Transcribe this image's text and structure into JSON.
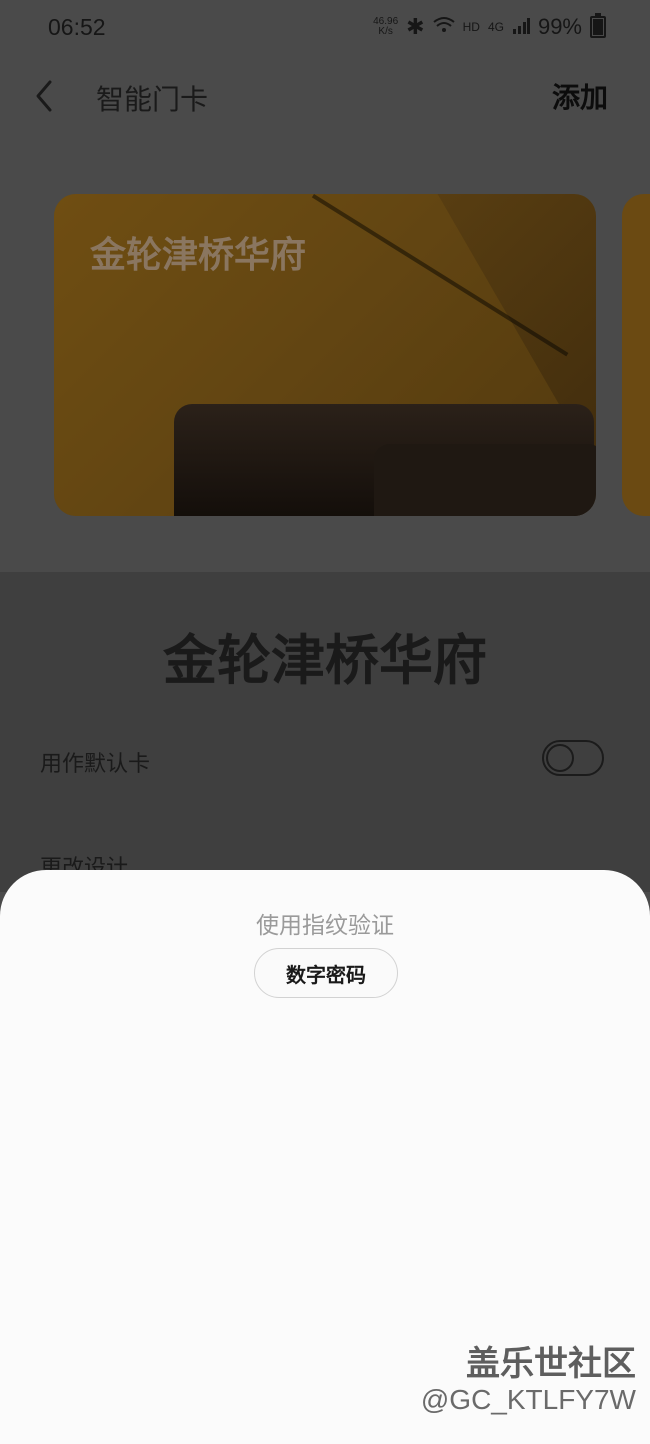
{
  "status_bar": {
    "time": "06:52",
    "net_speed_value": "46.96",
    "net_speed_unit": "K/s",
    "hd_label": "HD",
    "signal_label": "4G",
    "battery": "99%"
  },
  "header": {
    "title": "智能门卡",
    "add_label": "添加"
  },
  "card": {
    "name": "金轮津桥华府"
  },
  "details": {
    "card_title": "金轮津桥华府",
    "default_card_label": "用作默认卡",
    "change_design_label": "更改设计"
  },
  "sheet": {
    "prompt": "使用指纹验证",
    "pin_button": "数字密码"
  },
  "watermark": {
    "line1": "盖乐世社区",
    "line2": "@GC_KTLFY7W"
  }
}
